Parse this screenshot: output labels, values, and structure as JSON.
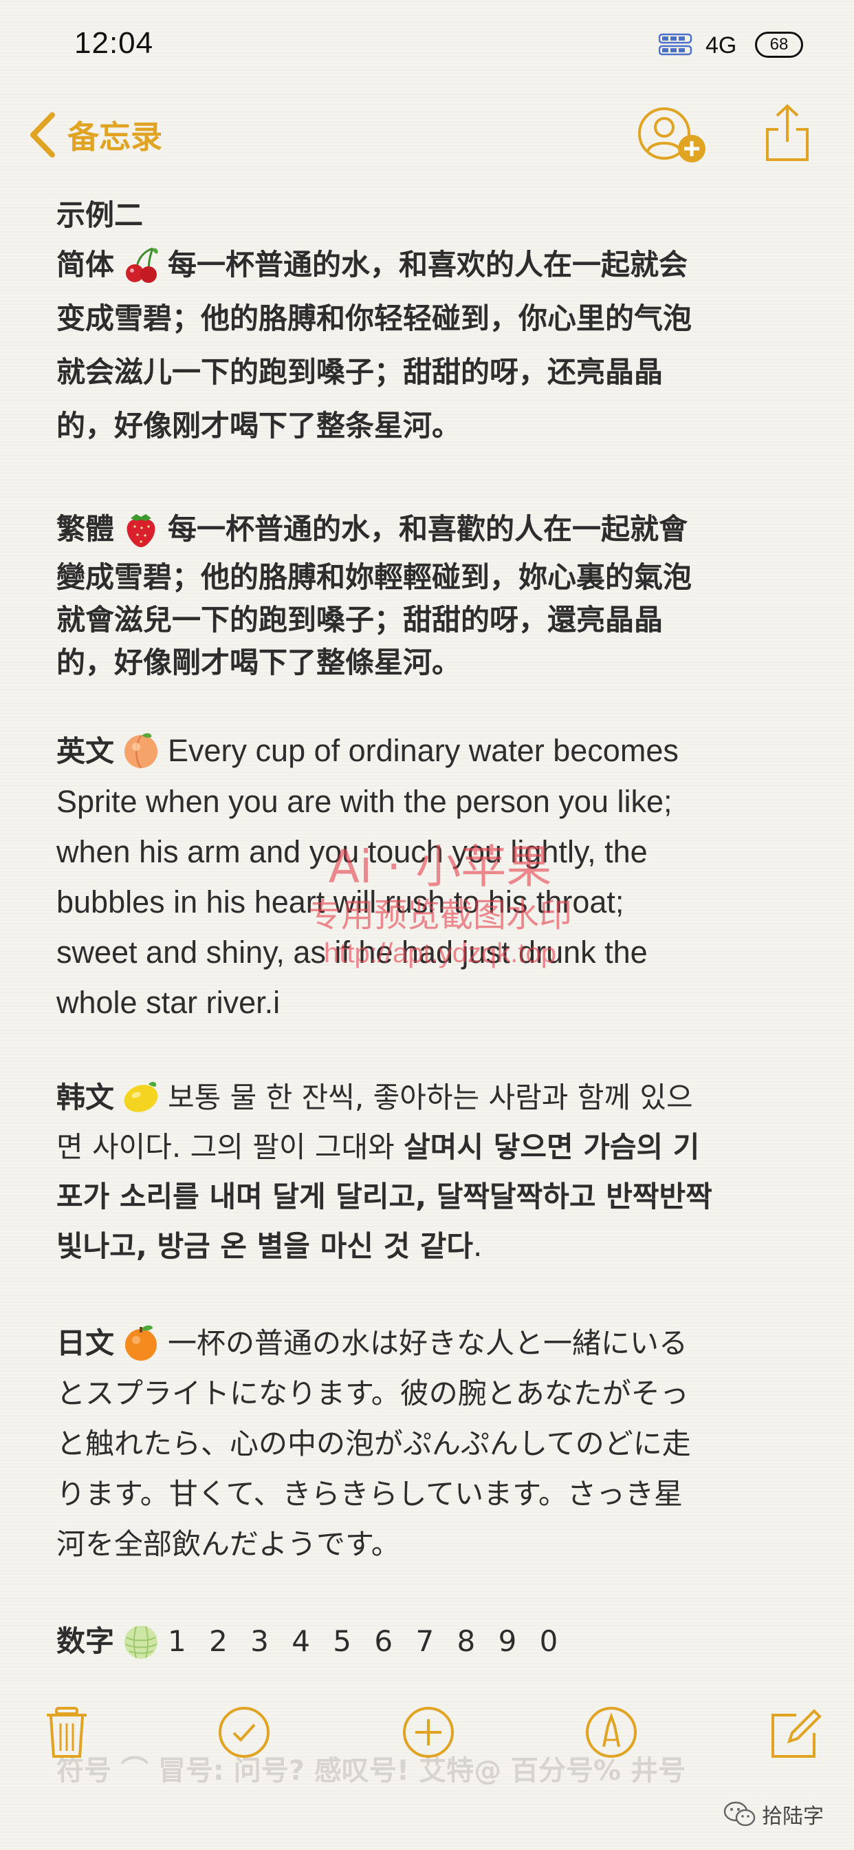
{
  "status_bar": {
    "time": "12:04",
    "network": "4G",
    "battery": "68"
  },
  "nav": {
    "back_label": "备忘录"
  },
  "note": {
    "title": "示例二",
    "simplified": {
      "label": "简体",
      "emoji": "cherries-icon",
      "line1": "每一杯普通的水，和喜欢的人在一起就会",
      "line2": "变成雪碧；他的胳膊和你轻轻碰到，你心里的气泡",
      "line3": "就会滋儿一下的跑到嗓子；甜甜的呀，还亮晶晶",
      "line4": "的，好像刚才喝下了整条星河。"
    },
    "traditional": {
      "label": "繁體",
      "emoji": "strawberry-icon",
      "line1": "每一杯普通的水，和喜歡的人在一起就會",
      "line2": "變成雪碧；他的胳膊和妳輕輕碰到，妳心裏的氣泡",
      "line3": "就會滋兒一下的跑到嗓子；甜甜的呀，還亮晶晶",
      "line4": "的，好像剛才喝下了整條星河。"
    },
    "english": {
      "label": "英文",
      "emoji": "peach-icon",
      "line1": "Every cup of ordinary water becomes",
      "line2": "Sprite when you are with the person you like;",
      "line3": "when his arm and you touch you lightly, the",
      "line4": "bubbles in his heart will rush to his throat;",
      "line5": "sweet and shiny, as if he had just drunk the",
      "line6": "whole star river.i"
    },
    "korean": {
      "label": "韩文",
      "emoji": "lemon-icon",
      "line1": "보통 물 한 잔씩, 좋아하는 사람과 함께 있으",
      "line2_normal": "면 사이다. 그의 팔이 그대와 ",
      "line2_bold": "살며시 닿으면 가슴의 기",
      "line3": "포가 소리를 내며 달게 달리고, 달짝달짝하고 반짝반짝",
      "line4_bold": "빛나고, 방금 온 별을 마신 것 같다",
      "line4_tail": "."
    },
    "japanese": {
      "label": "日文",
      "emoji": "orange-icon",
      "line1": "一杯の普通の水は好きな人と一緒にいる",
      "line2": "とスプライトになります。彼の腕とあなたがそっ",
      "line3": "と触れたら、心の中の泡がぷんぷんしてのどに走",
      "line4": "ります。甘くて、きらきらしています。さっき星",
      "line5": "河を全部飲んだようです。"
    },
    "digits": {
      "label": "数字",
      "emoji": "melon-icon",
      "value": "1 2 3 4 5 6 7 8 9 0"
    },
    "hidden_line": "符号 ⌒ 冒号: 问号? 感叹号! 艾特@ 百分号% 井号"
  },
  "watermark": {
    "line1": "Ai · 小苹果",
    "line2": "专用预览截图水印",
    "line3": "http://apt.ydzqk.top"
  },
  "credit": {
    "label": "拾陆字"
  },
  "colors": {
    "accent": "#e0a322",
    "watermark": "#e64650"
  }
}
